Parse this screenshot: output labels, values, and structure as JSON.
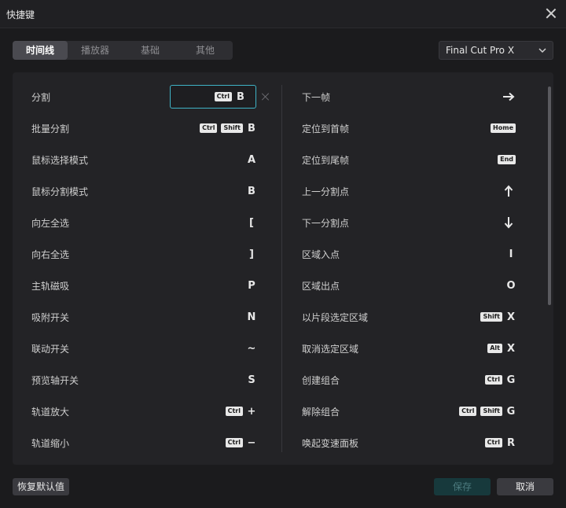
{
  "dialog": {
    "title": "快捷键"
  },
  "tabs": [
    {
      "label": "时间线",
      "active": true
    },
    {
      "label": "播放器",
      "active": false
    },
    {
      "label": "基础",
      "active": false
    },
    {
      "label": "其他",
      "active": false
    }
  ],
  "preset": {
    "selected": "Final Cut Pro X"
  },
  "left_shortcuts": [
    {
      "label": "分割",
      "keys": [
        "Ctrl",
        "B"
      ],
      "editing": true
    },
    {
      "label": "批量分割",
      "keys": [
        "Ctrl",
        "Shift",
        "B"
      ]
    },
    {
      "label": "鼠标选择模式",
      "keys": [
        "A"
      ]
    },
    {
      "label": "鼠标分割模式",
      "keys": [
        "B"
      ]
    },
    {
      "label": "向左全选",
      "keys": [
        "["
      ]
    },
    {
      "label": "向右全选",
      "keys": [
        "]"
      ]
    },
    {
      "label": "主轨磁吸",
      "keys": [
        "P"
      ]
    },
    {
      "label": "吸附开关",
      "keys": [
        "N"
      ]
    },
    {
      "label": "联动开关",
      "keys": [
        "~"
      ]
    },
    {
      "label": "预览轴开关",
      "keys": [
        "S"
      ]
    },
    {
      "label": "轨道放大",
      "keys": [
        "Ctrl",
        "+"
      ]
    },
    {
      "label": "轨道缩小",
      "keys": [
        "Ctrl",
        "−"
      ]
    }
  ],
  "right_shortcuts": [
    {
      "label": "下一帧",
      "keys": [
        "arrow-right"
      ]
    },
    {
      "label": "定位到首帧",
      "keys": [
        "Home"
      ]
    },
    {
      "label": "定位到尾帧",
      "keys": [
        "End"
      ]
    },
    {
      "label": "上一分割点",
      "keys": [
        "arrow-up"
      ]
    },
    {
      "label": "下一分割点",
      "keys": [
        "arrow-down"
      ]
    },
    {
      "label": "区域入点",
      "keys": [
        "I"
      ]
    },
    {
      "label": "区域出点",
      "keys": [
        "O"
      ]
    },
    {
      "label": "以片段选定区域",
      "keys": [
        "Shift",
        "X"
      ]
    },
    {
      "label": "取消选定区域",
      "keys": [
        "Alt",
        "X"
      ]
    },
    {
      "label": "创建组合",
      "keys": [
        "Ctrl",
        "G"
      ]
    },
    {
      "label": "解除组合",
      "keys": [
        "Ctrl",
        "Shift",
        "G"
      ]
    },
    {
      "label": "唤起变速面板",
      "keys": [
        "Ctrl",
        "R"
      ]
    }
  ],
  "footer": {
    "reset_label": "恢复默认值",
    "save_label": "保存",
    "cancel_label": "取消"
  },
  "colors": {
    "accent_border": "#3fb3c6",
    "save_disabled_bg": "#17393c"
  }
}
